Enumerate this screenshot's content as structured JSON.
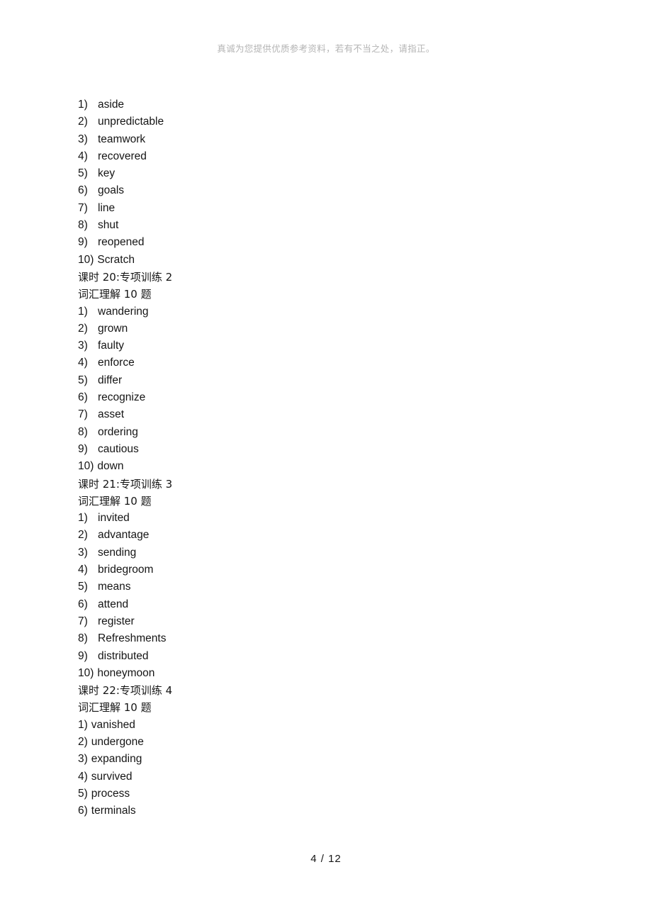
{
  "document": {
    "header_note": "真诚为您提供优质参考资料，若有不当之处，请指正。",
    "footer": {
      "page_number": "4",
      "separator": "/",
      "total_pages": "12",
      "text": "4 / 12"
    }
  },
  "sections": [
    {
      "id": "section-continued",
      "title": null,
      "subtitle": null,
      "items": [
        {
          "marker": "1)",
          "word": "aside"
        },
        {
          "marker": "2)",
          "word": "unpredictable"
        },
        {
          "marker": "3)",
          "word": "teamwork"
        },
        {
          "marker": "4)",
          "word": "recovered"
        },
        {
          "marker": "5)",
          "word": "key"
        },
        {
          "marker": "6)",
          "word": "goals"
        },
        {
          "marker": "7)",
          "word": "line"
        },
        {
          "marker": "8)",
          "word": "shut"
        },
        {
          "marker": "9)",
          "word": "reopened"
        },
        {
          "marker": "10)",
          "word": "Scratch"
        }
      ]
    },
    {
      "id": "section-lesson-20",
      "title": "课时 20:专项训练 2",
      "subtitle": "词汇理解 10 题",
      "items": [
        {
          "marker": "1)",
          "word": "wandering"
        },
        {
          "marker": "2)",
          "word": "grown"
        },
        {
          "marker": "3)",
          "word": "faulty"
        },
        {
          "marker": "4)",
          "word": "enforce"
        },
        {
          "marker": "5)",
          "word": "differ"
        },
        {
          "marker": "6)",
          "word": "recognize"
        },
        {
          "marker": "7)",
          "word": "asset"
        },
        {
          "marker": "8)",
          "word": "ordering"
        },
        {
          "marker": "9)",
          "word": "cautious"
        },
        {
          "marker": "10)",
          "word": "down"
        }
      ]
    },
    {
      "id": "section-lesson-21",
      "title": "课时 21:专项训练 3",
      "subtitle": "词汇理解 10 题",
      "items": [
        {
          "marker": "1)",
          "word": "invited"
        },
        {
          "marker": "2)",
          "word": "advantage"
        },
        {
          "marker": "3)",
          "word": "sending"
        },
        {
          "marker": "4)",
          "word": "bridegroom"
        },
        {
          "marker": "5)",
          "word": "means"
        },
        {
          "marker": "6)",
          "word": "attend"
        },
        {
          "marker": "7)",
          "word": "register"
        },
        {
          "marker": "8)",
          "word": "Refreshments"
        },
        {
          "marker": "9)",
          "word": "distributed"
        },
        {
          "marker": "10)",
          "word": "honeymoon"
        }
      ]
    },
    {
      "id": "section-lesson-22",
      "title": "课时 22:专项训练 4",
      "subtitle": "词汇理解 10 题",
      "items": [
        {
          "marker": "1)",
          "word": "vanished"
        },
        {
          "marker": "2)",
          "word": "undergone"
        },
        {
          "marker": "3)",
          "word": "expanding"
        },
        {
          "marker": "4)",
          "word": "survived"
        },
        {
          "marker": "5)",
          "word": "process"
        },
        {
          "marker": "6)",
          "word": "terminals"
        }
      ]
    }
  ]
}
